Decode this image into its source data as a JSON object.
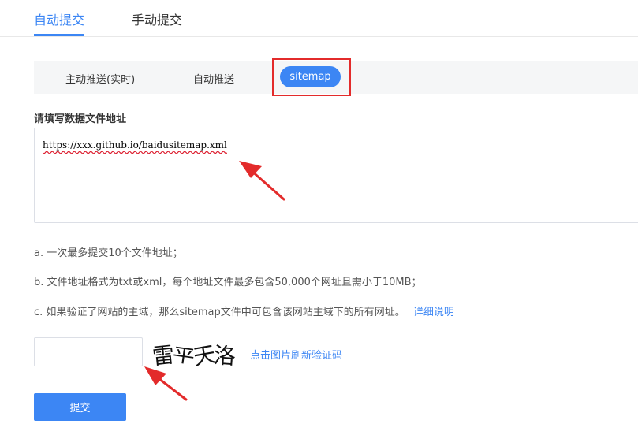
{
  "main_tabs": [
    {
      "label": "自动提交",
      "active": true
    },
    {
      "label": "手动提交",
      "active": false
    }
  ],
  "sub_tabs": [
    {
      "label": "主动推送(实时)",
      "active": false
    },
    {
      "label": "自动推送",
      "active": false
    },
    {
      "label": "sitemap",
      "active": true
    }
  ],
  "form": {
    "label": "请填写数据文件地址",
    "url_value": "https://xxx.github.io/baidusitemap.xml"
  },
  "notes": {
    "a": "a. 一次最多提交10个文件地址；",
    "b": "b. 文件地址格式为txt或xml，每个地址文件最多包含50,000个网址且需小于10MB；",
    "c": "c. 如果验证了网站的主域，那么sitemap文件中可包含该网站主域下的所有网址。",
    "c_link": "详细说明"
  },
  "captcha": {
    "input_value": "",
    "image_text": "雷平天洛",
    "refresh_label": "点击图片刷新验证码"
  },
  "submit_label": "提交",
  "colors": {
    "accent": "#3c86f4",
    "annotation_red": "#e32b2b",
    "subtab_bg": "#f5f6f7"
  }
}
